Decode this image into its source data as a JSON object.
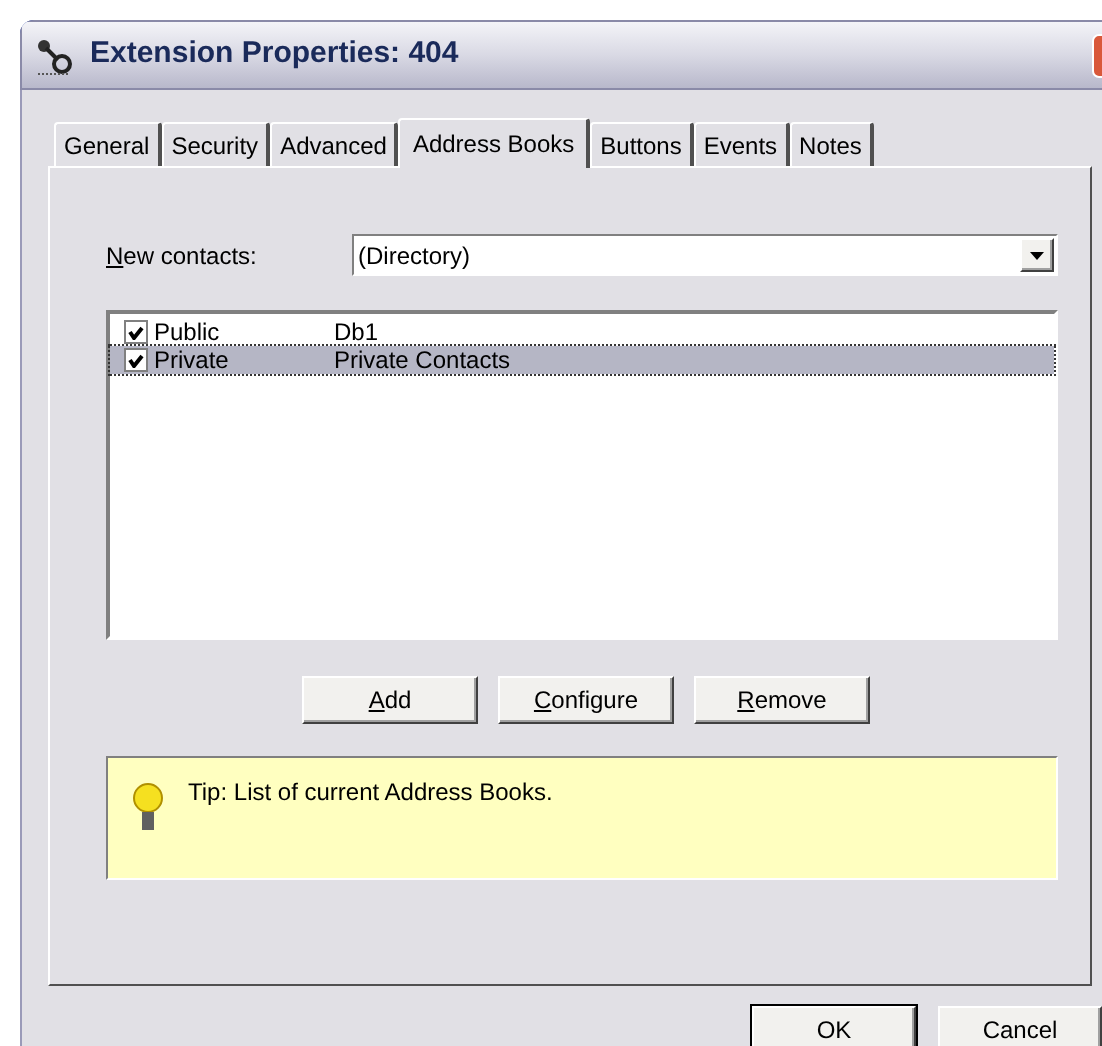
{
  "window": {
    "title": "Extension Properties: 404"
  },
  "tabs": [
    {
      "label": "General",
      "selected": false
    },
    {
      "label": "Security",
      "selected": false
    },
    {
      "label": "Advanced",
      "selected": false
    },
    {
      "label": "Address Books",
      "selected": true
    },
    {
      "label": "Buttons",
      "selected": false
    },
    {
      "label": "Events",
      "selected": false
    },
    {
      "label": "Notes",
      "selected": false
    }
  ],
  "new_contacts": {
    "label": {
      "key": "N",
      "rest": "ew contacts:"
    },
    "value": "(Directory)"
  },
  "address_books": [
    {
      "name": "Public",
      "database": "Db1",
      "checked": true,
      "selected": false
    },
    {
      "name": "Private",
      "database": "Private Contacts",
      "checked": true,
      "selected": true
    }
  ],
  "list_buttons": [
    {
      "key": "A",
      "rest": "dd"
    },
    {
      "key": "C",
      "rest": "onfigure"
    },
    {
      "key": "R",
      "rest": "emove"
    }
  ],
  "tip": "Tip:  List of current Address Books.",
  "buttons": [
    "OK",
    "Cancel"
  ]
}
